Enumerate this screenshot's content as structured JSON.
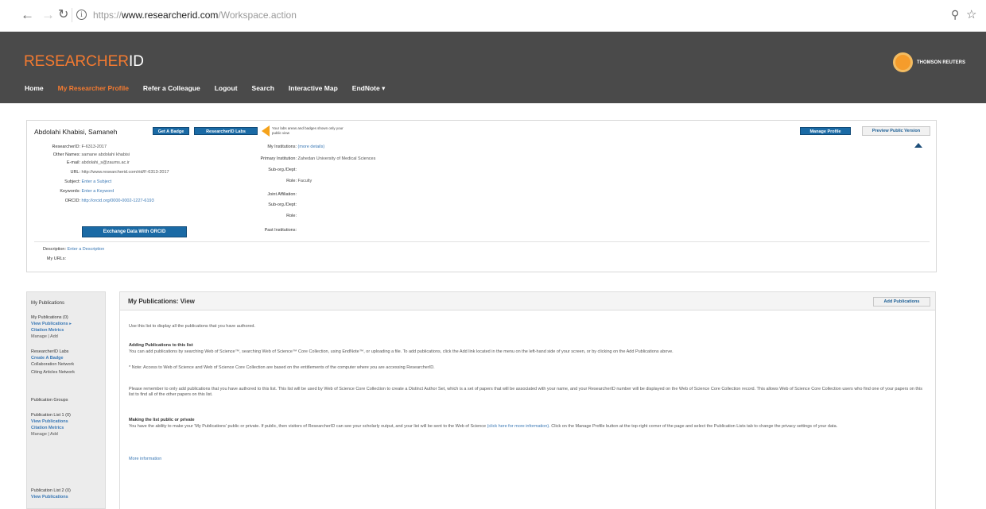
{
  "browser": {
    "url_scheme": "https://",
    "url_domain": "www.researcherid.com",
    "url_path": "/Workspace.action"
  },
  "header": {
    "logo_main": "RESEARCHER",
    "logo_id": "ID",
    "brand": "THOMSON REUTERS",
    "nav": [
      "Home",
      "My Researcher Profile",
      "Refer a Colleague",
      "Logout",
      "Search",
      "Interactive Map",
      "EndNote ▾"
    ],
    "colors": {
      "accent": "#f47a30",
      "bar": "#4a4a4a",
      "button_blue": "#1a6aa5"
    }
  },
  "profile": {
    "name": "Abdolahi Khabisi, Samaneh",
    "get_badge": "Get A Badge",
    "researcherid_labs": "ResearcherID Labs",
    "labs_tip": "Your labs areas and badges shown only your public view",
    "manage_profile": "Manage Profile",
    "preview_public": "Preview Public Version",
    "left_fields": [
      {
        "label": "ResearcherID:",
        "value": "F-6313-2017",
        "kind": "val"
      },
      {
        "label": "Other Names:",
        "value": "samane abdolahi khabisi",
        "kind": "val"
      },
      {
        "label": "E-mail:",
        "value": "abdolahi_s@zaums.ac.ir",
        "kind": "val"
      },
      {
        "label": "URL:",
        "value": "http://www.researcherid.com/rid/F-6313-2017",
        "kind": "val"
      },
      {
        "label": "Subject:",
        "value": "Enter a Subject",
        "kind": "link"
      },
      {
        "label": "Keywords:",
        "value": "Enter a Keyword",
        "kind": "link"
      },
      {
        "label": "ORCID:",
        "value": "http://orcid.org/0000-0002-1227-6193",
        "kind": "link"
      }
    ],
    "right_fields": [
      {
        "label": "My Institutions:",
        "value": "(more details)",
        "kind": "link"
      },
      {
        "label": "Primary Institution:",
        "value": "Zahedan University of Medical Sciences",
        "kind": "val"
      },
      {
        "label": "Sub-org./Dept:",
        "value": "",
        "kind": "val"
      },
      {
        "label": "Role:",
        "value": "Faculty",
        "kind": "val"
      },
      {
        "label": "Joint Affiliation:",
        "value": "",
        "kind": "val"
      },
      {
        "label": "Sub-org./Dept:",
        "value": "",
        "kind": "val"
      },
      {
        "label": "Role:",
        "value": "",
        "kind": "val"
      },
      {
        "label": "Past Institutions:",
        "value": "",
        "kind": "val"
      }
    ],
    "exchange_orcid": "Exchange Data With ORCID",
    "description_label": "Description:",
    "description_value": "Enter a Description",
    "myurls_label": "My URLs:"
  },
  "sidebar": {
    "my_publications": "My Publications",
    "my_publications_count": "My Publications (0)",
    "view_publications": "View Publications ▸",
    "citation_metrics": "Citation Metrics",
    "manage_add": "Manage | Add",
    "labs": "ResearcherID Labs",
    "create_badge": "Create A Badge",
    "collab_network": "Collaboration Network",
    "citing_network": "Citing Articles Network",
    "pub_groups": "Publication Groups",
    "list1": "Publication List 1 (0)",
    "list1_view": "View Publications",
    "list1_metrics": "Citation Metrics",
    "list1_manage": "Manage | Add",
    "list2": "Publication List 2 (0)",
    "list2_view": "View Publications"
  },
  "main": {
    "title": "My Publications: View",
    "add_publications": "Add Publications",
    "intro": "Use this list to display all the publications that you have authored.",
    "adding_heading": "Adding Publications to this list",
    "adding_text": "You can add publications by searching Web of Science™, searching Web of Science™ Core Collection, using EndNote™, or uploading a file. To add publications, click the Add link located in the menu on the left-hand side of your screen, or by clicking on the Add Publications above.",
    "note_text": "* Note: Access to Web of Science and Web of Science Core Collection are based on the entitlements of the computer where you are accessing ResearcherID.",
    "remember_text": "Please remember to only add publications that you have authored to this list. This list will be used by Web of Science Core Collection to create a Distinct Author Set, which is a set of papers that will be associated with your name, and your ResearcherID number will be displayed on the Web of Science Core Collection record. This allows Web of Science Core Collection users who find one of your papers on this list to find all of the other papers on this list.",
    "public_heading": "Making the list public or private",
    "public_text_1": "You have the ability to make your 'My Publications' public or private. If public, then visitors of ResearcherID can see your scholarly output, and your list will be sent to the Web of Science",
    "public_link": "(click here for more information).",
    "public_text_2": "Click on the Manage Profile button at the top-right corner of the page and select the Publication Lists tab to change the privacy settings of your data.",
    "more_info": "More information"
  }
}
